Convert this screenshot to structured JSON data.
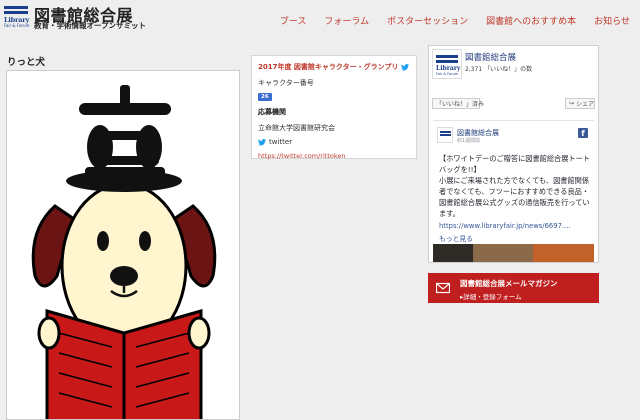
{
  "header": {
    "logo_title": "図書館総合展",
    "logo_subtitle": "教育・学術情報オープンサミット",
    "logo_mark_text": "Library",
    "logo_mark_sub": "Fair & Forum",
    "nav": [
      "ブース",
      "フォーラム",
      "ポスターセッション",
      "図書館へのおすすめ本",
      "お知らせ"
    ]
  },
  "page_title": "りっと犬",
  "info": {
    "title": "2017年度 図書館キャラクター・グランプリ",
    "number_label": "キャラクター番号",
    "number_badge": "26",
    "applicant_label": "応募機関",
    "applicant": "立命館大学図書館研究会",
    "twitter_label": "twitter",
    "twitter_url": "https://twitter.com/rittoken"
  },
  "facebook": {
    "page_name": "図書館総合展",
    "likes": "2,371 「いいね！」の数",
    "like_button": "「いいね！」済み",
    "share_button": "シェア",
    "post_name": "図書館総合展",
    "post_time": "約1週間前",
    "post_text": "【ホワイトデーのご贈答に図書館総合展トートバッグを!!】\n小展にご来場された方でなくても、図書館関係者でなくても、フツーにおすすめできる良品・図書館総合展公式グッズの通信販売を行っています。",
    "post_link": "https://www.libraryfair.jp/news/6697....",
    "more": "もっと見る"
  },
  "mail": {
    "title": "図書館総合展メールマガジン",
    "sub": "▸詳細・登録フォーム"
  },
  "colors": {
    "accent": "#c0392b",
    "brand_blue": "#1b3f8b",
    "mail_bg": "#bf1f1f",
    "badge": "#3a6fcf"
  }
}
